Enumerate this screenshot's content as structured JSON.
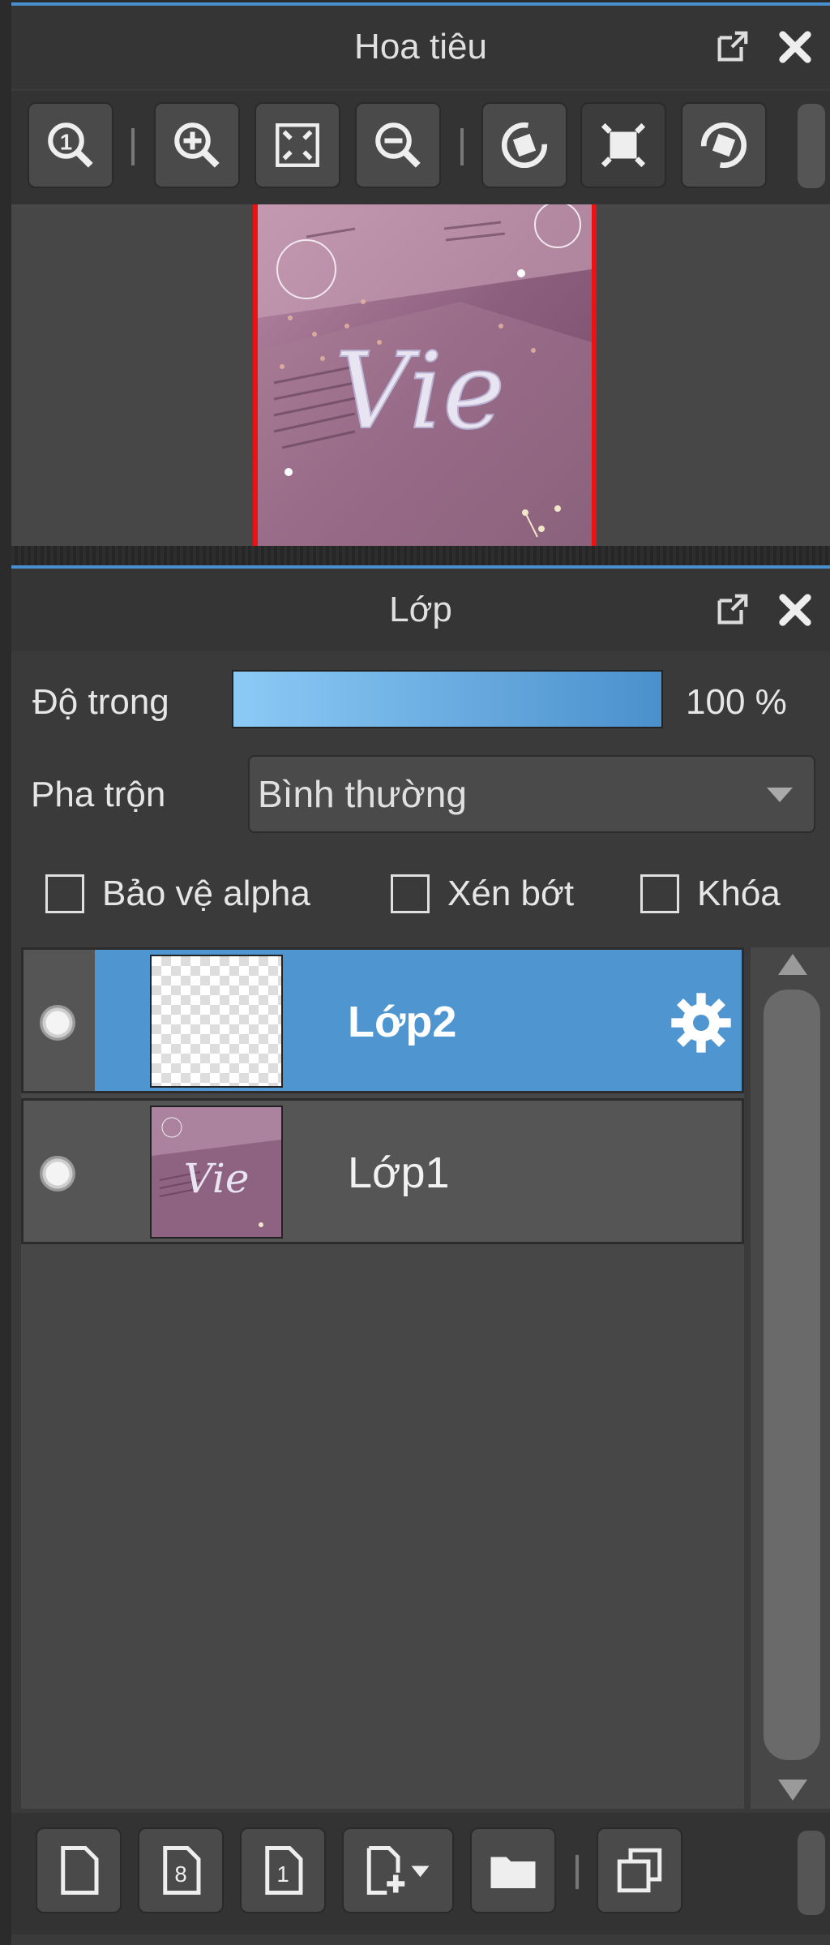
{
  "navigator": {
    "title": "Hoa tiêu",
    "toolbar": [
      {
        "icon": "zoom-actual-icon",
        "label": "1"
      },
      {
        "icon": "zoom-in-icon"
      },
      {
        "icon": "fit-window-icon"
      },
      {
        "icon": "zoom-out-icon"
      },
      {
        "icon": "rotate-left-icon"
      },
      {
        "icon": "reset-rotation-icon"
      },
      {
        "icon": "rotate-right-icon"
      }
    ],
    "preview_text": "Vie"
  },
  "layers": {
    "title": "Lớp",
    "opacity_label": "Độ trong",
    "opacity_value": "100 %",
    "opacity": 1.0,
    "blend_label": "Pha trộn",
    "blend_value": "Bình thường",
    "checkboxes": [
      {
        "label": "Bảo vệ alpha",
        "checked": false
      },
      {
        "label": "Xén bớt",
        "checked": false
      },
      {
        "label": "Khóa",
        "checked": false
      }
    ],
    "items": [
      {
        "name": "Lớp2",
        "selected": true,
        "thumbnail": "transparent"
      },
      {
        "name": "Lớp1",
        "selected": false,
        "thumbnail": "image"
      }
    ],
    "bottom_toolbar": [
      {
        "icon": "new-layer-icon"
      },
      {
        "icon": "new-8bit-layer-icon",
        "label": "8"
      },
      {
        "icon": "new-1bit-layer-icon",
        "label": "1"
      },
      {
        "icon": "add-layer-menu-icon"
      },
      {
        "icon": "folder-icon"
      },
      {
        "icon": "duplicate-layer-icon"
      }
    ]
  },
  "colors": {
    "accent": "#4a8fd0",
    "selected_row": "#4f96d0",
    "frame_red": "#ee1111",
    "panel_bg": "#3a3a3a"
  }
}
